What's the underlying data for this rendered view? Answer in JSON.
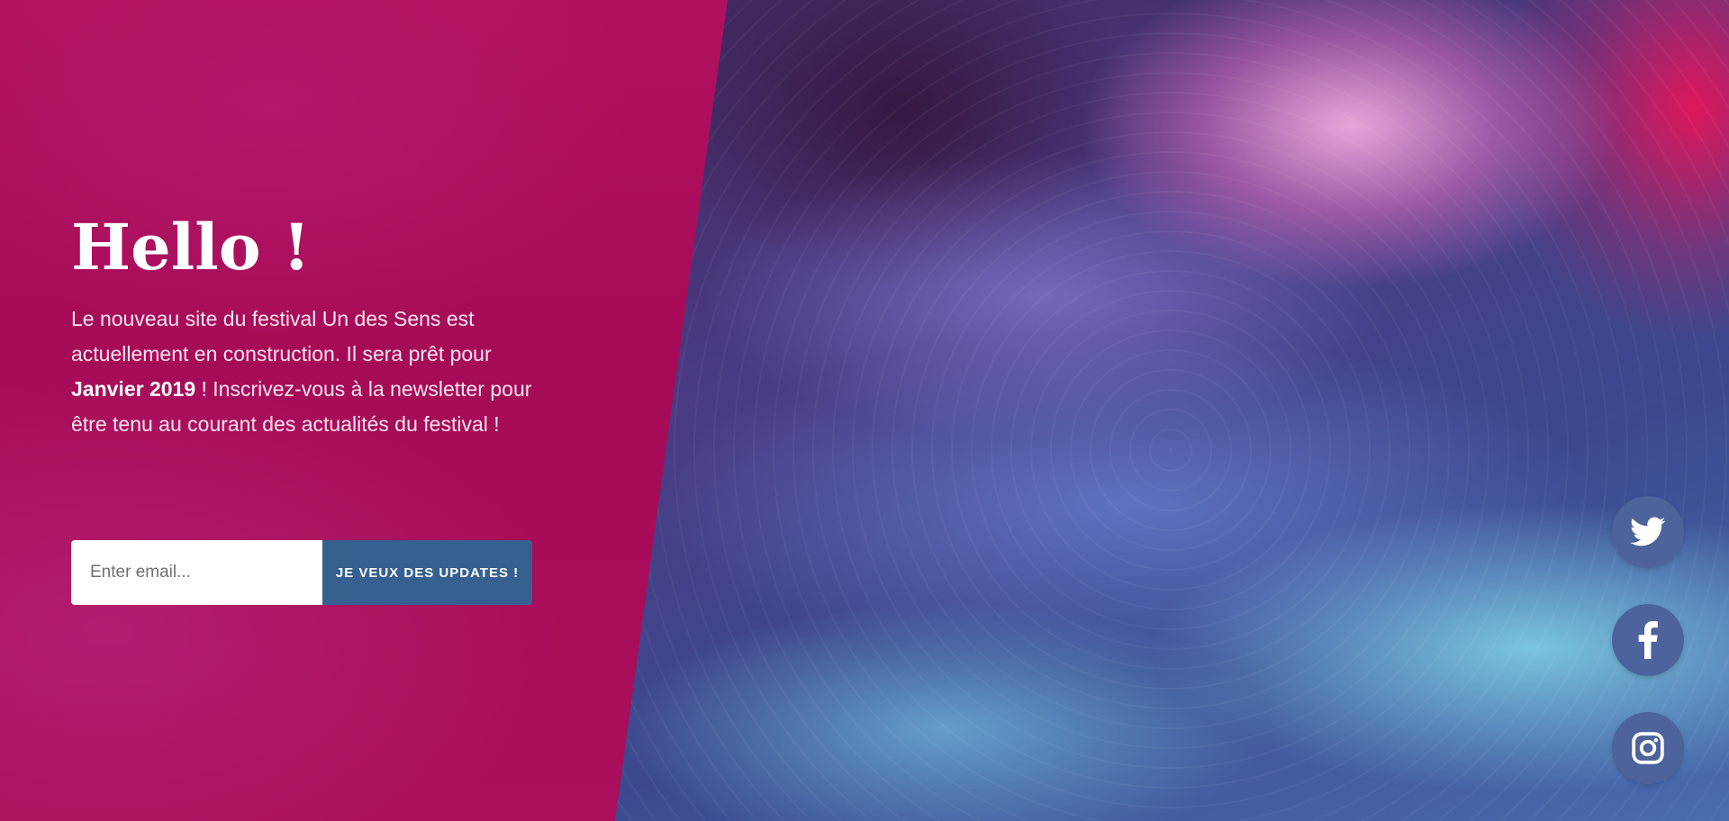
{
  "hero": {
    "title": "Hello !",
    "intro_line_1": "Le nouveau site du festival Un des Sens est actuellement en construction. Il sera prêt pour",
    "intro_highlight": "Janvier 2019",
    "intro_line_2": " ! Inscrivez-vous à la newsletter pour être tenu au courant des actualités du festival !"
  },
  "signup": {
    "email_placeholder": "Enter email...",
    "email_value": "",
    "submit_label": "JE VEUX DES UPDATES !"
  },
  "social": {
    "items": [
      {
        "name": "Twitter",
        "icon": "twitter-icon"
      },
      {
        "name": "Facebook",
        "icon": "facebook-icon"
      },
      {
        "name": "Instagram",
        "icon": "instagram-icon"
      }
    ]
  },
  "colors": {
    "panel": "#a90f5c",
    "button": "#35608f",
    "social_button": "#4d639b"
  }
}
